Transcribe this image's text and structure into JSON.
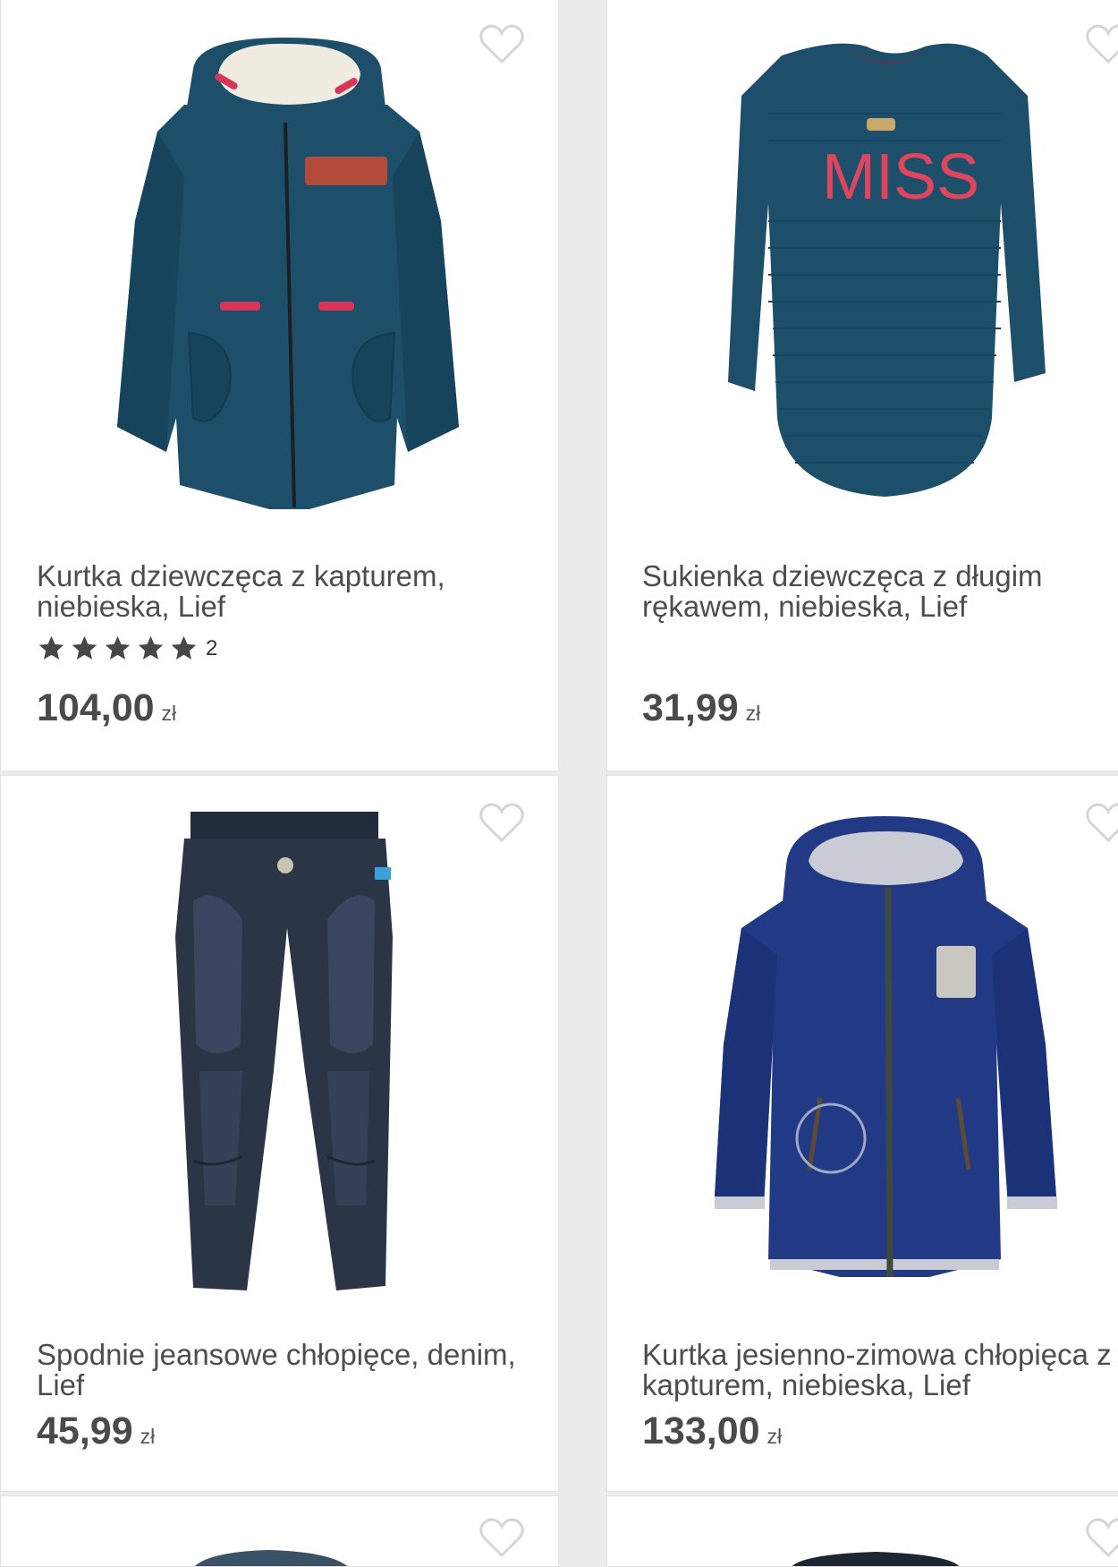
{
  "products": [
    {
      "title": "Kurtka dziewczęca z kapturem, niebieska, Lief",
      "rating_count": "2",
      "stars": 5,
      "price": "104,00",
      "currency": "zł",
      "image": "girls-parka-jacket"
    },
    {
      "title": "Sukienka dziewczęca z długim rękawem, niebieska, Lief",
      "price": "31,99",
      "currency": "zł",
      "image": "girls-dress-miss",
      "print_text": "MISS"
    },
    {
      "title": "Spodnie jeansowe chłopięce, denim, Lief",
      "price": "45,99",
      "currency": "zł",
      "image": "boys-jeans"
    },
    {
      "title": "Kurtka jesienno-zimowa chłopięca z kapturem, niebieska, Lief",
      "price": "133,00",
      "currency": "zł",
      "image": "boys-winter-jacket"
    }
  ],
  "colors": {
    "petrol": "#1d4f6b",
    "navy": "#223a86",
    "denim": "#2b3546",
    "accent_red": "#d9345a"
  }
}
